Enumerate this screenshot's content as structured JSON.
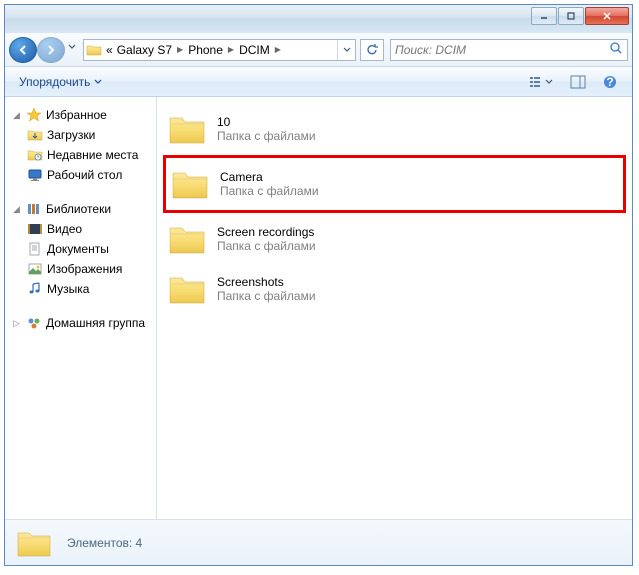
{
  "titlebar": {},
  "breadcrumbs": {
    "pre": "«",
    "items": [
      "Galaxy S7",
      "Phone",
      "DCIM"
    ]
  },
  "search": {
    "placeholder": "Поиск: DCIM"
  },
  "toolbar": {
    "organize": "Упорядочить"
  },
  "nav": {
    "favorites": {
      "label": "Избранное",
      "items": [
        {
          "label": "Загрузки",
          "icon": "downloads"
        },
        {
          "label": "Недавние места",
          "icon": "recent"
        },
        {
          "label": "Рабочий стол",
          "icon": "desktop"
        }
      ]
    },
    "libraries": {
      "label": "Библиотеки",
      "items": [
        {
          "label": "Видео",
          "icon": "video"
        },
        {
          "label": "Документы",
          "icon": "documents"
        },
        {
          "label": "Изображения",
          "icon": "pictures"
        },
        {
          "label": "Музыка",
          "icon": "music"
        }
      ]
    },
    "homegroup": {
      "label": "Домашняя группа"
    }
  },
  "content": {
    "subtype": "Папка с файлами",
    "items": [
      {
        "name": "10",
        "highlight": false
      },
      {
        "name": "Camera",
        "highlight": true
      },
      {
        "name": "Screen recordings",
        "highlight": false
      },
      {
        "name": "Screenshots",
        "highlight": false
      }
    ]
  },
  "status": {
    "text": "Элементов: 4"
  }
}
